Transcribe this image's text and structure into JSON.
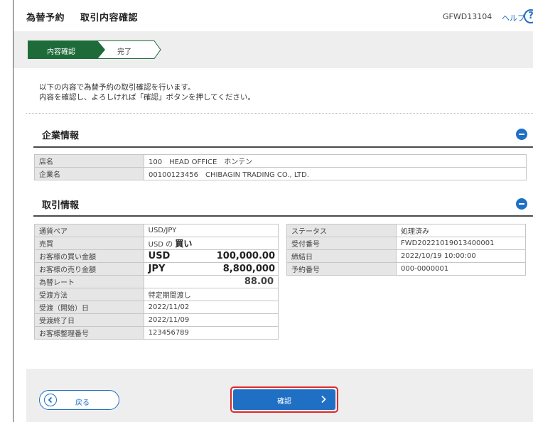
{
  "header": {
    "title_part1": "為替予約",
    "title_part2": "取引内容確認",
    "screen_id": "GFWD13104",
    "help_label": "ヘルプ",
    "help_icon_glyph": "?"
  },
  "steps": [
    {
      "label": "内容確認",
      "active": true
    },
    {
      "label": "完了",
      "active": false
    }
  ],
  "intro": {
    "line1": "以下の内容で為替予約の取引確認を行います。",
    "line2": "内容を確認し、よろしければ「確認」ボタンを押してください。"
  },
  "company_section": {
    "title": "企業情報",
    "rows": [
      {
        "label": "店名",
        "value": "100　HEAD OFFICE　ホンテン"
      },
      {
        "label": "企業名",
        "value": "00100123456　CHIBAGIN TRADING CO., LTD."
      }
    ]
  },
  "trade_section": {
    "title": "取引情報",
    "left_rows": {
      "pair": {
        "label": "通貨ペア",
        "value": "USD/JPY"
      },
      "buysell": {
        "label": "売買",
        "prefix": "USD の",
        "value": "買い"
      },
      "buy_amount": {
        "label": "お客様の買い金額",
        "currency": "USD",
        "amount": "100,000.00"
      },
      "sell_amount": {
        "label": "お客様の売り金額",
        "currency": "JPY",
        "amount": "8,800,000"
      },
      "rate": {
        "label": "為替レート",
        "value": "88.00"
      },
      "delivery_method": {
        "label": "受渡方法",
        "value": "特定期間渡し"
      },
      "delivery_start": {
        "label": "受渡（開始）日",
        "value": "2022/11/02"
      },
      "delivery_end": {
        "label": "受渡終了日",
        "value": "2022/11/09"
      },
      "ref_no": {
        "label": "お客様整理番号",
        "value": "123456789"
      }
    },
    "right_rows": [
      {
        "label": "ステータス",
        "value": "処理済み"
      },
      {
        "label": "受付番号",
        "value": "FWD20221019013400001"
      },
      {
        "label": "締結日",
        "value": "2022/10/19 10:00:00"
      },
      {
        "label": "予約番号",
        "value": "000-0000001"
      }
    ]
  },
  "footer": {
    "back_label": "戻る",
    "confirm_label": "確認"
  },
  "colors": {
    "accent_blue": "#1f6fc5",
    "step_active": "#1e6b3a",
    "highlight_red": "#e0282b"
  }
}
